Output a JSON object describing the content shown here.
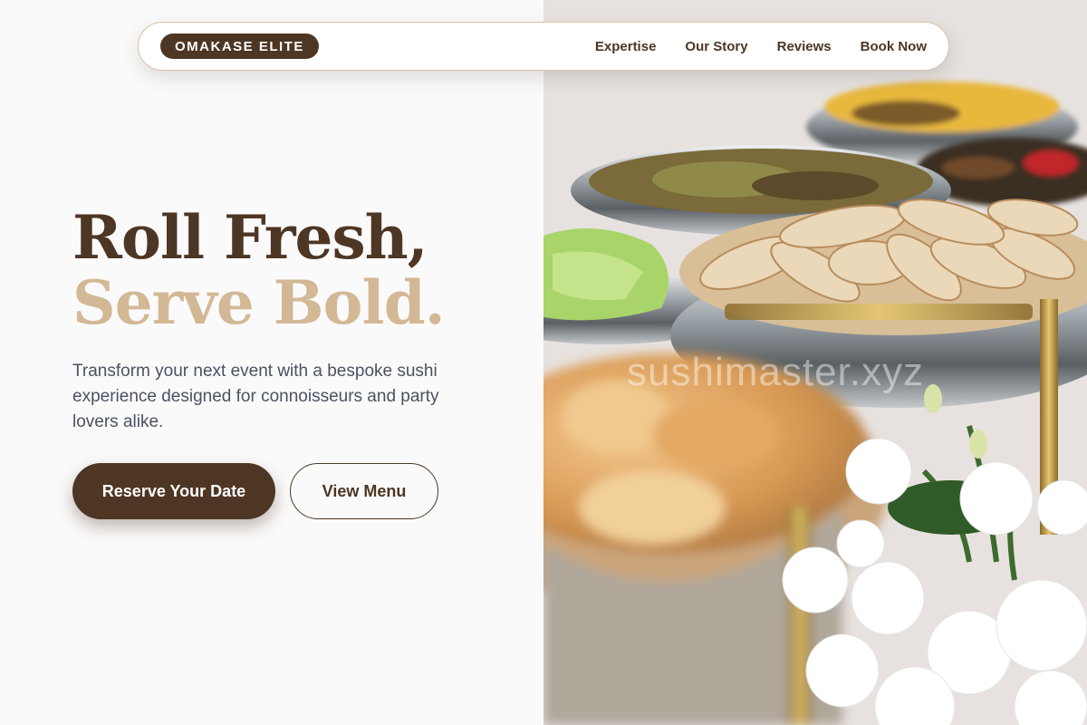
{
  "nav": {
    "brand": "OMAKASE ELITE",
    "links": [
      "Expertise",
      "Our Story",
      "Reviews",
      "Book Now"
    ]
  },
  "hero": {
    "title_line1": "Roll Fresh,",
    "title_line2": "Serve Bold.",
    "subtitle": "Transform your next event with a bespoke sushi experience designed for connoisseurs and party lovers alike.",
    "primary_cta": "Reserve Your Date",
    "secondary_cta": "View Menu"
  },
  "image": {
    "watermark": "sushimaster.xyz"
  },
  "colors": {
    "brand_brown": "#4d3623",
    "accent_tan": "#d3b896",
    "text_gray": "#4a5262",
    "background": "#fbfafa"
  }
}
